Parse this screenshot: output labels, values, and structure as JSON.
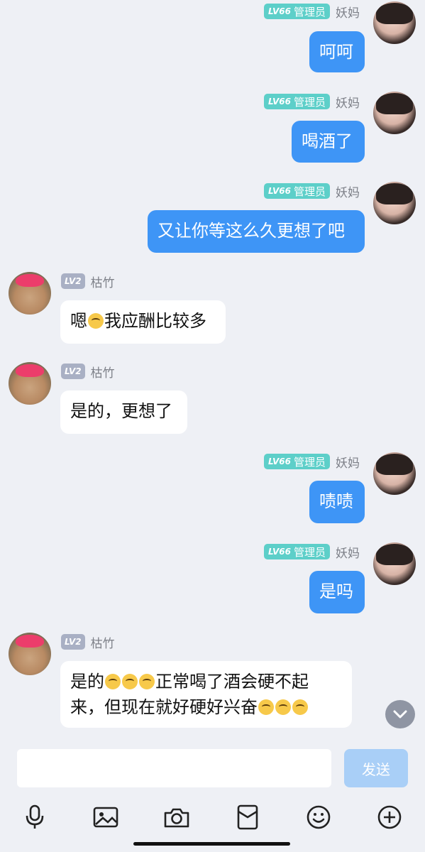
{
  "messages": [
    {
      "side": "right",
      "level": "LV66",
      "role": "管理员",
      "name": "妖妈",
      "text": "呵呵"
    },
    {
      "side": "right",
      "level": "LV66",
      "role": "管理员",
      "name": "妖妈",
      "text": "喝酒了"
    },
    {
      "side": "right",
      "level": "LV66",
      "role": "管理员",
      "name": "妖妈",
      "text": "又让你等这么久更想了吧"
    },
    {
      "side": "left",
      "level": "LV2",
      "name": "枯竹",
      "text_a": "嗯",
      "text_b": "我应酬比较多"
    },
    {
      "side": "left",
      "level": "LV2",
      "name": "枯竹",
      "text": "是的，更想了"
    },
    {
      "side": "right",
      "level": "LV66",
      "role": "管理员",
      "name": "妖妈",
      "text": "啧啧"
    },
    {
      "side": "right",
      "level": "LV66",
      "role": "管理员",
      "name": "妖妈",
      "text": "是吗"
    },
    {
      "side": "left",
      "level": "LV2",
      "name": "枯竹",
      "text_a": "是的",
      "text_b": "正常喝了酒会硬不起",
      "text_c": "来，但现在就好硬好兴奋"
    }
  ],
  "input": {
    "placeholder": "",
    "send_label": "发送"
  },
  "toolbar": [
    "microphone-icon",
    "image-icon",
    "camera-icon",
    "red-packet-icon",
    "emoji-icon",
    "plus-icon"
  ],
  "colors": {
    "bubble_self": "#3e95f6",
    "bubble_other": "#ffffff",
    "admin_badge": "#5dcfc9",
    "user_badge": "#a9b0c4",
    "background": "#eef0f5"
  }
}
